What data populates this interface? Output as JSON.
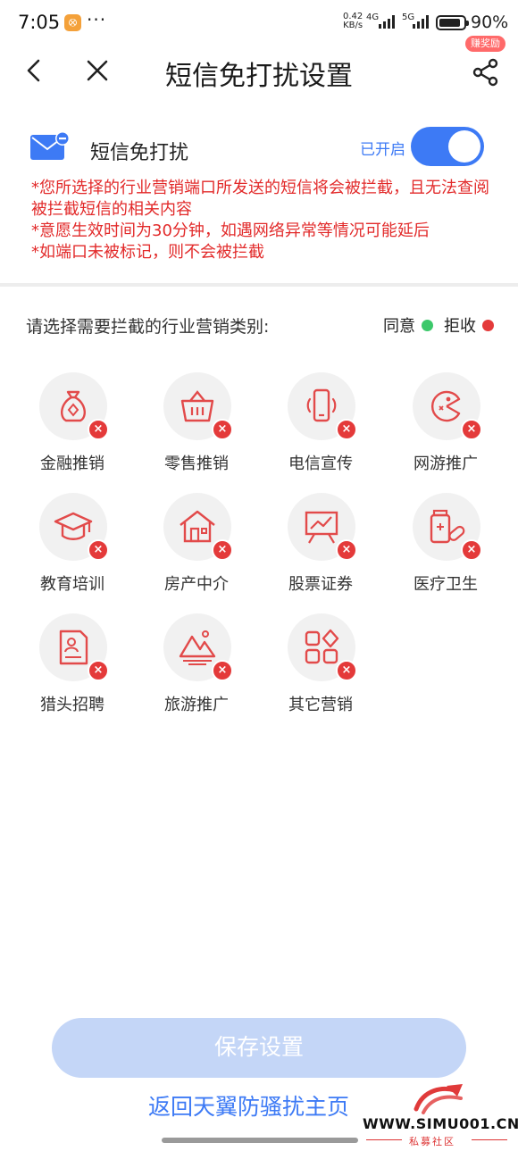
{
  "status_bar": {
    "time": "7:05",
    "app_badge": "⭙",
    "more": "···",
    "speed_value": "0.42",
    "speed_unit": "KB/s",
    "net1": "4G",
    "net2": "5G",
    "battery_percent": 90,
    "battery_text": "90%"
  },
  "header": {
    "title": "短信免打扰设置",
    "reward_badge": "赚奖励"
  },
  "sms_block": {
    "label": "短信免打扰",
    "state_label": "已开启",
    "enabled": true
  },
  "notes": [
    "*您所选择的行业营销端口所发送的短信将会被拦截，且无法查阅被拦截短信的相关内容",
    "*意愿生效时间为30分钟，如遇网络异常等情况可能延后",
    "*如端口未被标记，则不会被拦截"
  ],
  "section": {
    "prompt": "请选择需要拦截的行业营销类别:",
    "legend_agree": "同意",
    "legend_reject": "拒收"
  },
  "categories": [
    {
      "name": "金融推销",
      "icon": "money-bag-icon",
      "state": "reject"
    },
    {
      "name": "零售推销",
      "icon": "shopping-basket-icon",
      "state": "reject"
    },
    {
      "name": "电信宣传",
      "icon": "phone-signal-icon",
      "state": "reject"
    },
    {
      "name": "网游推广",
      "icon": "game-icon",
      "state": "reject"
    },
    {
      "name": "教育培训",
      "icon": "graduation-cap-icon",
      "state": "reject"
    },
    {
      "name": "房产中介",
      "icon": "house-icon",
      "state": "reject"
    },
    {
      "name": "股票证券",
      "icon": "stock-chart-icon",
      "state": "reject"
    },
    {
      "name": "医疗卫生",
      "icon": "medicine-icon",
      "state": "reject"
    },
    {
      "name": "猎头招聘",
      "icon": "resume-icon",
      "state": "reject"
    },
    {
      "name": "旅游推广",
      "icon": "mountain-icon",
      "state": "reject"
    },
    {
      "name": "其它营销",
      "icon": "grid-apps-icon",
      "state": "reject"
    }
  ],
  "reject_mark": "×",
  "save_button": "保存设置",
  "return_link": "返回天翼防骚扰主页",
  "watermark": {
    "url": "WWW.SIMU001.CN",
    "cn": "私募社区"
  },
  "colors": {
    "accent": "#3d7af5",
    "reject": "#e43a3a",
    "agree": "#3cc86a",
    "icon_red": "#e24a4a",
    "disabled_button": "#c4d6f7"
  }
}
